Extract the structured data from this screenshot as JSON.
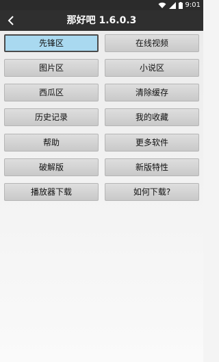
{
  "status_bar": {
    "time": "9:01"
  },
  "header": {
    "title": "那好吧 1.6.0.3"
  },
  "buttons": {
    "pioneer": "先锋区",
    "online_video": "在线视频",
    "images": "图片区",
    "novels": "小说区",
    "xigua": "西瓜区",
    "clear_cache": "清除缓存",
    "history": "历史记录",
    "favorites": "我的收藏",
    "help": "帮助",
    "more_software": "更多软件",
    "crack": "破解版",
    "new_features": "新版特性",
    "player_download": "播放器下载",
    "how_to_download": "如何下载?"
  },
  "colors": {
    "selected": "#a9d9f0",
    "toolbar": "#2f2f2f"
  }
}
